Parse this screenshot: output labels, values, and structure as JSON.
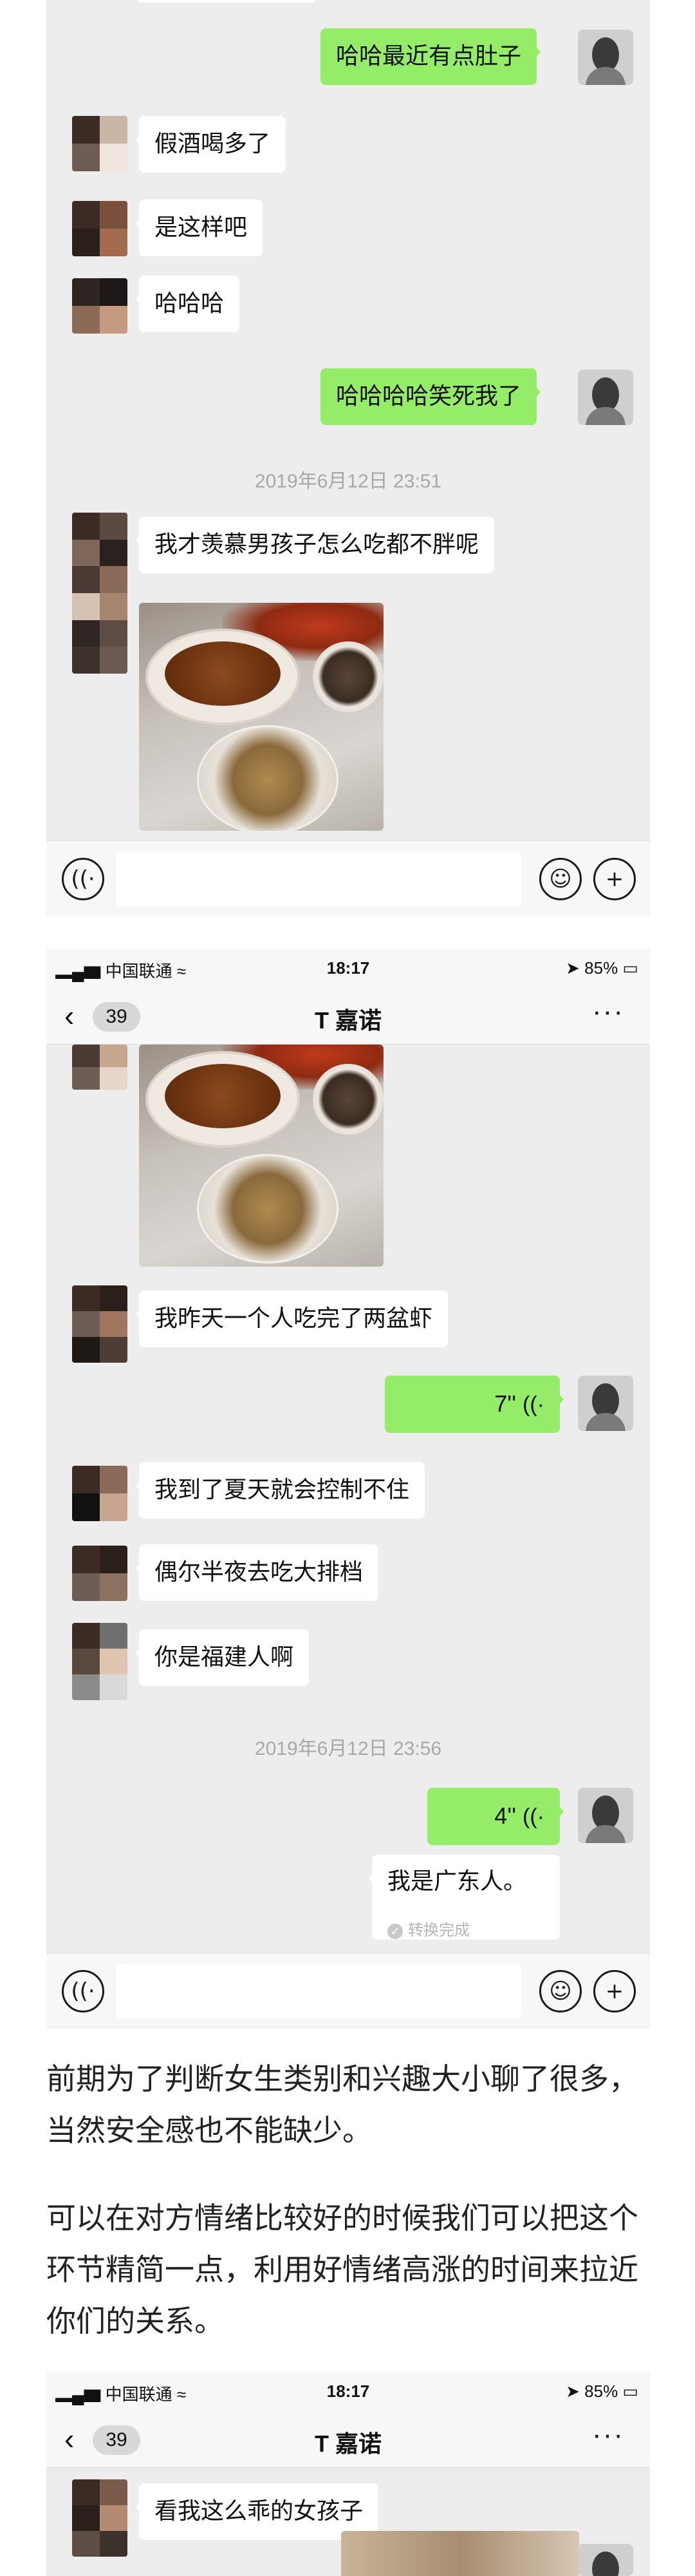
{
  "screen1": {
    "messages": [
      {
        "side": "right",
        "text": "哈哈最近有点肚子"
      },
      {
        "side": "left",
        "text": "假酒喝多了"
      },
      {
        "side": "left",
        "text": "是这样吧"
      },
      {
        "side": "left",
        "text": "哈哈哈"
      },
      {
        "side": "right",
        "text": "哈哈哈哈笑死我了"
      }
    ],
    "timestamp": "2019年6月12日 23:51",
    "message_after_ts": "我才羡慕男孩子怎么吃都不胖呢"
  },
  "statusbar": {
    "carrier": "▂▄▆ 中国联通 ≈",
    "time": "18:17",
    "battery": "➤ 85%",
    "battery_icon": "▭"
  },
  "navbar": {
    "back_icon": "‹",
    "unread_count": "39",
    "title": "T 嘉诺",
    "more_icon": "···"
  },
  "screen2": {
    "messages": [
      {
        "side": "left",
        "text": "我昨天一个人吃完了两盆虾"
      },
      {
        "side": "right",
        "voice": "7''"
      },
      {
        "side": "left",
        "text": "我到了夏天就会控制不住"
      },
      {
        "side": "left",
        "text": "偶尔半夜去吃大排档"
      },
      {
        "side": "left",
        "text": "你是福建人啊"
      }
    ],
    "timestamp": "2019年6月12日 23:56",
    "voice2": "4''",
    "transcript": "我是广东人。",
    "transcript_status": "转换完成"
  },
  "article": {
    "paragraph1": "前期为了判断女生类别和兴趣大小聊了很多，当然安全感也不能缺少。",
    "paragraph2": "可以在对方情绪比较好的时候我们可以把这个环节精简一点，利用好情绪高涨的时间来拉近你们的关系。"
  },
  "screen3": {
    "messages": [
      {
        "side": "left",
        "text": "看我这么乖的女孩子"
      }
    ]
  },
  "icons": {
    "voice": "((·",
    "emoji": "☺",
    "plus": "+"
  },
  "colors": {
    "chat_bg": "#ededed",
    "bubble_mine": "#95ec69",
    "bubble_theirs": "#ffffff"
  }
}
